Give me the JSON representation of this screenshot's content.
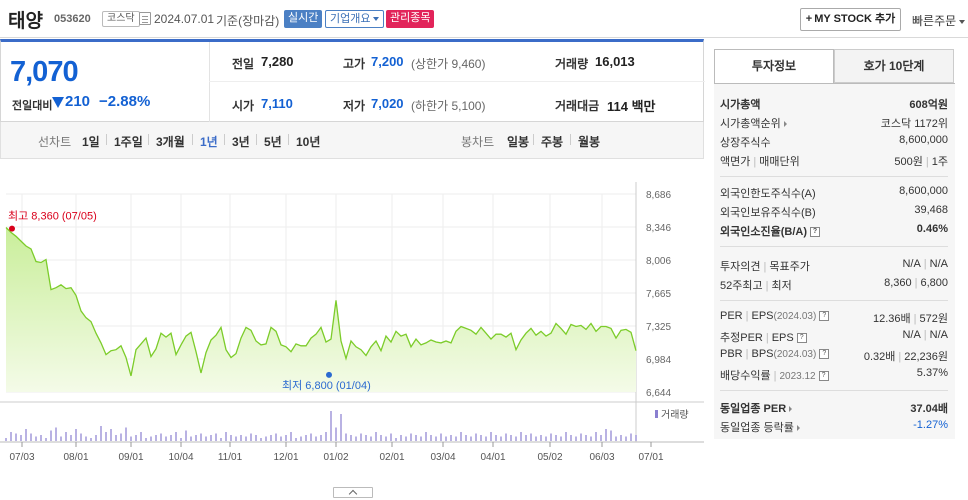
{
  "header": {
    "stock_name": "태양",
    "stock_code": "053620",
    "market": "코스닥",
    "date": "2024.07.01",
    "date_basis": "기준(장마감)",
    "realtime_label": "실시간",
    "company_label": "기업개요",
    "managed_label": "관리종목",
    "mystock_label": "MY STOCK 추가",
    "quick_order_label": "빠른주문"
  },
  "price": {
    "current": "7,070",
    "vs_label": "전일대비",
    "change": "210",
    "change_rate": "−2.88%",
    "direction": "down",
    "color_down": "#1361d3"
  },
  "stats": {
    "prev_label": "전일",
    "prev_value": "7,280",
    "high_label": "고가",
    "high_value": "7,200",
    "upper_limit": "(상한가 9,460)",
    "volume_label": "거래량",
    "volume_value": "16,013",
    "open_label": "시가",
    "open_value": "7,110",
    "low_label": "저가",
    "low_value": "7,020",
    "lower_limit": "(하한가 5,100)",
    "amount_label": "거래대금",
    "amount_value": "114 백만"
  },
  "chart_tabs": {
    "line_label": "선차트",
    "line_periods": [
      "1일",
      "1주일",
      "3개월",
      "1년",
      "3년",
      "5년",
      "10년"
    ],
    "active_period": "1년",
    "candle_label": "봉차트",
    "candle_periods": [
      "일봉",
      "주봉",
      "월봉"
    ]
  },
  "chart_data": {
    "type": "area",
    "y_ticks": [
      "8,686",
      "8,346",
      "8,006",
      "7,665",
      "7,325",
      "6,984",
      "6,644"
    ],
    "ylim": [
      6644,
      8686
    ],
    "x_ticks": [
      "07/03",
      "08/01",
      "09/01",
      "10/04",
      "11/01",
      "12/01",
      "01/02",
      "02/01",
      "03/04",
      "04/01",
      "05/02",
      "06/03",
      "07/01"
    ],
    "high_label": "최고 8,360 (07/05)",
    "low_label": "최저 6,800 (01/04)",
    "high_value": 8360,
    "low_value": 6800,
    "volume_label": "거래량",
    "series": [
      {
        "values": [
          8340,
          8290,
          8250,
          8200,
          8150,
          8120,
          7990,
          7980,
          8010,
          7700,
          7720,
          7750,
          7710,
          7720,
          7640,
          7480,
          7410,
          7370,
          7250,
          7150,
          7030,
          7070,
          7080,
          7120,
          7000,
          6810,
          7080,
          7140,
          7200,
          7010,
          7090,
          7250,
          7210,
          7250,
          7030,
          7130,
          7220,
          7260,
          7060,
          6840,
          7050,
          7180,
          7230,
          7310,
          7080,
          7000,
          7040,
          7200,
          7310,
          7280,
          7170,
          7130,
          7140,
          7310,
          7270,
          7130,
          7110,
          7060,
          7140,
          7120,
          7120,
          7200,
          7240,
          7310,
          7160,
          7190,
          7590,
          7170,
          6990,
          7170,
          7110,
          7080,
          7020,
          7110,
          7170,
          7070,
          7220,
          7160,
          7270,
          7220,
          7240,
          7110,
          7190,
          7130,
          7150,
          7180,
          7160,
          7150,
          7170,
          7150,
          7270,
          7320,
          7300,
          7280,
          7240,
          7310,
          7250,
          7190,
          7240,
          7240,
          7210,
          7250,
          7080,
          7180,
          7250,
          7300,
          7230,
          7270,
          7220,
          7250,
          7350,
          7300,
          7240,
          7340,
          7320,
          7330,
          7290,
          7350,
          7270,
          7320,
          7320,
          7300,
          7200,
          7280,
          7290,
          7260,
          7070
        ]
      }
    ],
    "volume": [
      2,
      6,
      5,
      4,
      8,
      5,
      3,
      4,
      2,
      7,
      9,
      3,
      6,
      4,
      8,
      5,
      3,
      2,
      4,
      10,
      6,
      8,
      4,
      5,
      9,
      3,
      4,
      6,
      2,
      3,
      4,
      5,
      3,
      4,
      6,
      2,
      7,
      3,
      4,
      5,
      3,
      4,
      5,
      2,
      6,
      4,
      3,
      4,
      3,
      5,
      4,
      2,
      3,
      4,
      5,
      3,
      4,
      6,
      2,
      3,
      4,
      5,
      3,
      4,
      6,
      20,
      9,
      18,
      5,
      4,
      3,
      5,
      4,
      3,
      6,
      4,
      3,
      5,
      2,
      4,
      3,
      5,
      4,
      3,
      6,
      4,
      3,
      5,
      3,
      4,
      3,
      6,
      4,
      3,
      5,
      4,
      3,
      6,
      4,
      3,
      5,
      4,
      3,
      6,
      4,
      5,
      3,
      4,
      3,
      5,
      4,
      3,
      6,
      4,
      3,
      5,
      4,
      3,
      6,
      4,
      8,
      7,
      3,
      4,
      3,
      5,
      4
    ]
  },
  "panel": {
    "tab_invest": "투자정보",
    "tab_hoga": "호가 10단계",
    "rows1": [
      {
        "k": "시가총액",
        "v": "608억원"
      },
      {
        "k": "시가총액순위",
        "v": "코스닥 1172위"
      },
      {
        "k": "상장주식수",
        "v": "8,600,000"
      },
      {
        "k": "액면가",
        "k2": "매매단위",
        "v": "500원",
        "v2": "1주"
      }
    ],
    "rows2": [
      {
        "k": "외국인한도주식수(A)",
        "v": "8,600,000"
      },
      {
        "k": "외국인보유주식수(B)",
        "v": "39,468"
      },
      {
        "k": "외국인소진율(B/A)",
        "v": "0.46%"
      }
    ],
    "rows3": [
      {
        "k": "투자의견",
        "k2": "목표주가",
        "v": "N/A",
        "v2": "N/A"
      },
      {
        "k": "52주최고",
        "k2": "최저",
        "v": "8,360",
        "v2": "6,800"
      }
    ],
    "rows4": [
      {
        "k": "PER",
        "k2": "EPS",
        "k3": "(2024.03)",
        "v": "12.36배",
        "v2": "572원"
      },
      {
        "k": "추정PER",
        "k2": "EPS",
        "v": "N/A",
        "v2": "N/A"
      },
      {
        "k": "PBR",
        "k2": "BPS",
        "k3": "(2024.03)",
        "v": "0.32배",
        "v2": "22,236원"
      },
      {
        "k": "배당수익률",
        "k3": "2023.12",
        "v": "5.37%"
      }
    ],
    "rows5": [
      {
        "k": "동일업종 PER",
        "v": "37.04배"
      },
      {
        "k": "동일업종 등락률",
        "v": "-1.27%"
      }
    ]
  }
}
